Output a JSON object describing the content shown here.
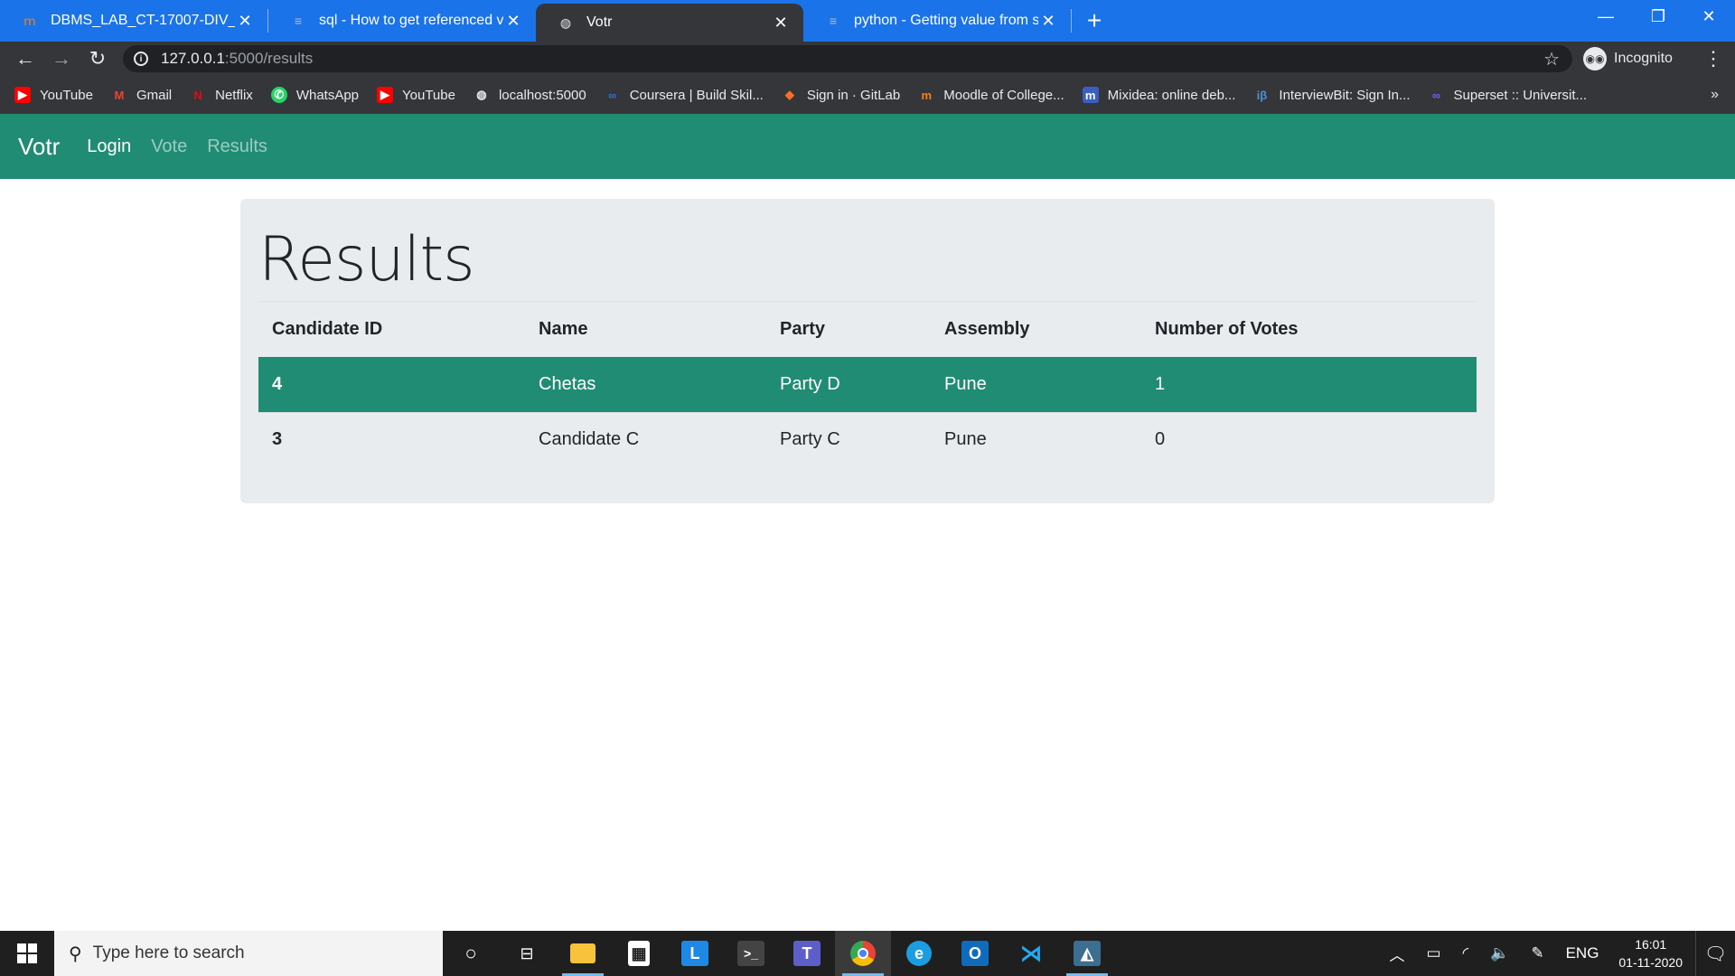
{
  "browser": {
    "tabs": [
      {
        "title": "DBMS_LAB_CT-17007-DIV_II-20-",
        "icon": "moodle-icon",
        "active": false
      },
      {
        "title": "sql - How to get referenced valu",
        "icon": "stackoverflow-icon",
        "active": false
      },
      {
        "title": "Votr",
        "icon": "globe-icon",
        "active": true
      },
      {
        "title": "python - Getting value from sele",
        "icon": "stackoverflow-icon",
        "active": false
      }
    ],
    "url_host": "127.0.0.1",
    "url_path": ":5000/results",
    "profile_label": "Incognito",
    "bookmarks": [
      {
        "label": "YouTube",
        "icon": "youtube-icon",
        "color": "#ff0000"
      },
      {
        "label": "Gmail",
        "icon": "gmail-icon",
        "color": "#ea4335"
      },
      {
        "label": "Netflix",
        "icon": "netflix-icon",
        "color": "#e50914"
      },
      {
        "label": "WhatsApp",
        "icon": "whatsapp-icon",
        "color": "#25d366"
      },
      {
        "label": "YouTube",
        "icon": "youtube-icon",
        "color": "#ff0000"
      },
      {
        "label": "localhost:5000",
        "icon": "globe-icon",
        "color": "#e8eaed"
      },
      {
        "label": "Coursera | Build Skil...",
        "icon": "coursera-icon",
        "color": "#2a73cc"
      },
      {
        "label": "Sign in · GitLab",
        "icon": "gitlab-icon",
        "color": "#fc6d26"
      },
      {
        "label": "Moodle of College...",
        "icon": "moodle-icon",
        "color": "#f98012"
      },
      {
        "label": "Mixidea: online deb...",
        "icon": "mixidea-icon",
        "color": "#3b5fc0"
      },
      {
        "label": "InterviewBit: Sign In...",
        "icon": "interviewbit-icon",
        "color": "#4a90d9"
      },
      {
        "label": "Superset :: Universit...",
        "icon": "superset-icon",
        "color": "#6c63ff"
      }
    ]
  },
  "app": {
    "brand": "Votr",
    "nav": [
      "Login",
      "Vote",
      "Results"
    ],
    "accent": "#218c74"
  },
  "results": {
    "heading": "Results",
    "columns": [
      "Candidate ID",
      "Name",
      "Party",
      "Assembly",
      "Number of Votes"
    ],
    "rows": [
      {
        "id": "4",
        "name": "Chetas",
        "party": "Party D",
        "assembly": "Pune",
        "votes": "1"
      },
      {
        "id": "3",
        "name": "Candidate C",
        "party": "Party C",
        "assembly": "Pune",
        "votes": "0"
      }
    ]
  },
  "taskbar": {
    "search_placeholder": "Type here to search",
    "language": "ENG",
    "time": "16:01",
    "date": "01-11-2020"
  }
}
